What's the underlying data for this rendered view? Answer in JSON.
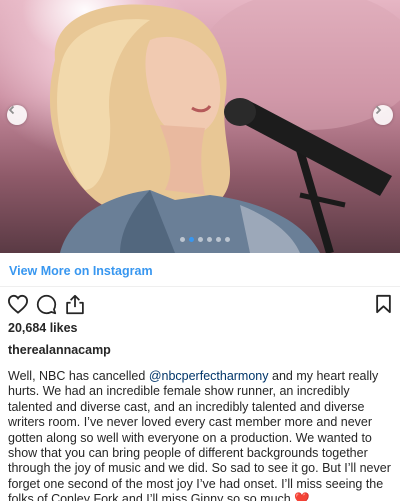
{
  "post": {
    "image_alt": "Woman singing into a microphone",
    "carousel": {
      "total": 6,
      "active_index": 1
    }
  },
  "links": {
    "view_more": "View More on Instagram"
  },
  "actions": {
    "like_icon": "heart-outline-icon",
    "comment_icon": "comment-bubble-icon",
    "share_icon": "share-upload-icon",
    "save_icon": "bookmark-icon"
  },
  "stats": {
    "likes": "20,684 likes"
  },
  "author": {
    "username": "therealannacamp"
  },
  "caption": {
    "before_mention": "Well, NBC has cancelled ",
    "mention": "@nbcperfectharmony",
    "after_mention": " and my heart really hurts. We had an incredible female show runner, an incredibly talented and diverse cast, and an incredibly talented and diverse writers room. I’ve never loved every cast member more and never gotten along so well with everyone on a production. We wanted to show that you can bring people of different backgrounds together through the joy of music and we did. So sad to see it go. But I’ll never forget one second of the most joy I’ve had onset. I’ll miss seeing the folks of Conley Fork and I’ll miss Ginny so so much ",
    "emoji": "❤️"
  },
  "colors": {
    "link_blue": "#3897f0",
    "mention_blue": "#003569",
    "text": "#262626"
  }
}
